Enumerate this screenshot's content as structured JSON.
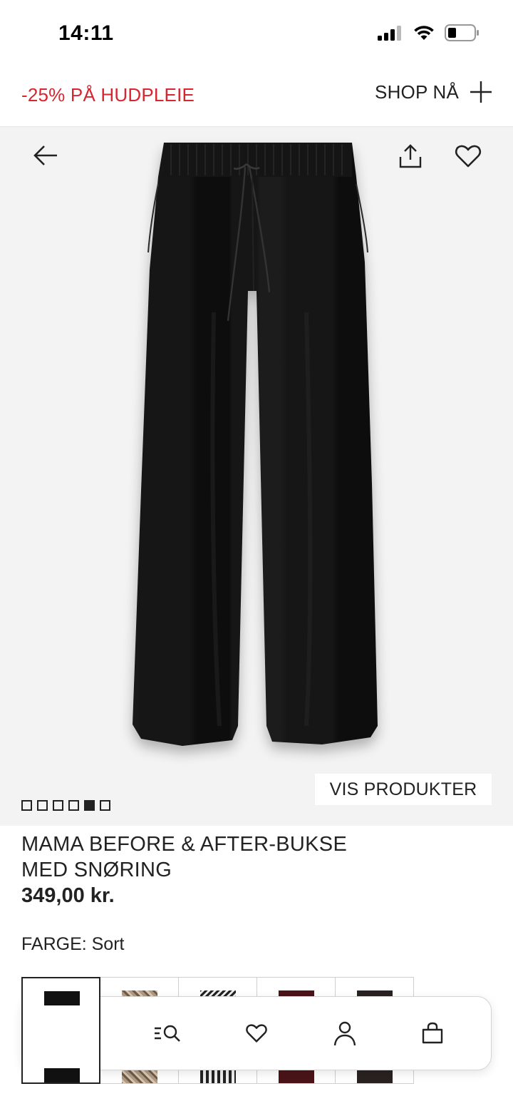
{
  "status_bar": {
    "time": "14:11"
  },
  "promo": {
    "text": "-25% PÅ HUDPLEIE",
    "cta_label": "SHOP NÅ"
  },
  "gallery": {
    "cta_label": "VIS PRODUKTER",
    "image_count": 6,
    "active_index": 4,
    "product_color": "#111111"
  },
  "product": {
    "title_line1": "MAMA BEFORE & AFTER-BUKSE",
    "title_line2": "MED SNØRING",
    "price": "349,00 kr.",
    "color_label": "FARGE: Sort"
  },
  "swatches": [
    {
      "name": "Sort",
      "color": "#111111",
      "selected": true
    },
    {
      "name": "Leopard",
      "color": "#a08870",
      "selected": false
    },
    {
      "name": "Mønstret",
      "color": "#777777",
      "selected": false
    },
    {
      "name": "Burgunder",
      "color": "#4a1418",
      "selected": false
    },
    {
      "name": "Mørk brun",
      "color": "#2a2220",
      "selected": false
    }
  ],
  "bottom_nav": {
    "items": [
      {
        "icon": "home-icon"
      },
      {
        "icon": "search-icon"
      },
      {
        "icon": "heart-icon"
      },
      {
        "icon": "account-icon"
      },
      {
        "icon": "shopping-bag-icon"
      }
    ]
  },
  "colors": {
    "promo_red": "#d7262f",
    "text": "#222222",
    "gallery_bg": "#f3f3f3"
  }
}
